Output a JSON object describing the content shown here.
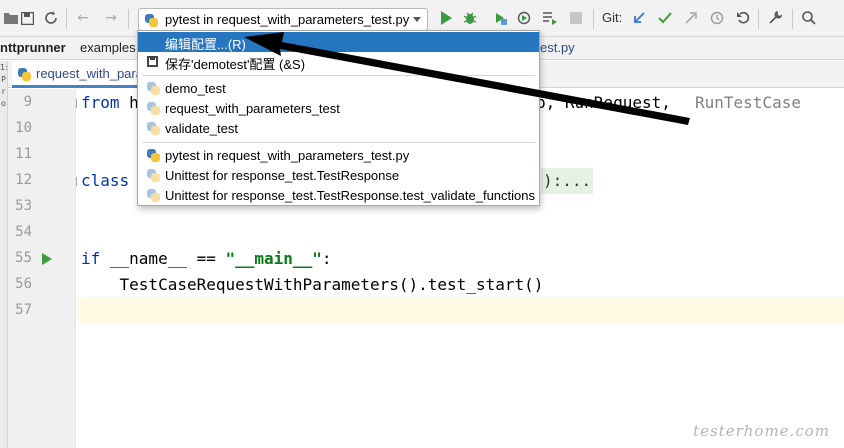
{
  "toolbar": {
    "run_config_label": "pytest in request_with_parameters_test.py",
    "git_label": "Git:"
  },
  "breadcrumb": {
    "project": "nttprunner",
    "folder": "examples",
    "file_tail": "est.py"
  },
  "editor_tab": {
    "label": "request_with_para"
  },
  "side_strip": [
    "1:",
    "P",
    "r",
    "o"
  ],
  "gutter": {
    "line_numbers": [
      "9",
      "10",
      "11",
      "12",
      "53",
      "54",
      "55",
      "56",
      "57"
    ]
  },
  "code": {
    "line9": {
      "kw": "from",
      "rest": " h",
      "tail": "p, RunRequest, ",
      "tail_gray": "RunTestCase"
    },
    "line12": {
      "kw": "class",
      "placeholder": "):..."
    },
    "line55": {
      "kw": "if",
      "mid": " __name__ == ",
      "str": "\"__main__\"",
      "end": ":"
    },
    "line56": {
      "text": "    TestCaseRequestWithParameters().test_start()"
    }
  },
  "popup": {
    "items": [
      {
        "label": "编辑配置...(R)",
        "icon": "none",
        "selected": true
      },
      {
        "label": "保存'demotest'配置 (&S)",
        "icon": "save-icon"
      },
      {
        "label": "demo_test",
        "icon": "python-faded-icon"
      },
      {
        "label": "request_with_parameters_test",
        "icon": "python-faded-icon"
      },
      {
        "label": "validate_test",
        "icon": "python-faded-icon"
      },
      {
        "label": "pytest in request_with_parameters_test.py",
        "icon": "python-icon"
      },
      {
        "label": "Unittest for response_test.TestResponse",
        "icon": "python-faded-icon"
      },
      {
        "label": "Unittest for response_test.TestResponse.test_validate_functions",
        "icon": "python-faded-icon"
      }
    ]
  },
  "watermark": "testerhome.com",
  "colors": {
    "selection": "#2675bf",
    "keyword": "#0033b3",
    "string": "#067d17",
    "annotation_arrow": "#000000",
    "run_green": "#3e9a3e"
  }
}
